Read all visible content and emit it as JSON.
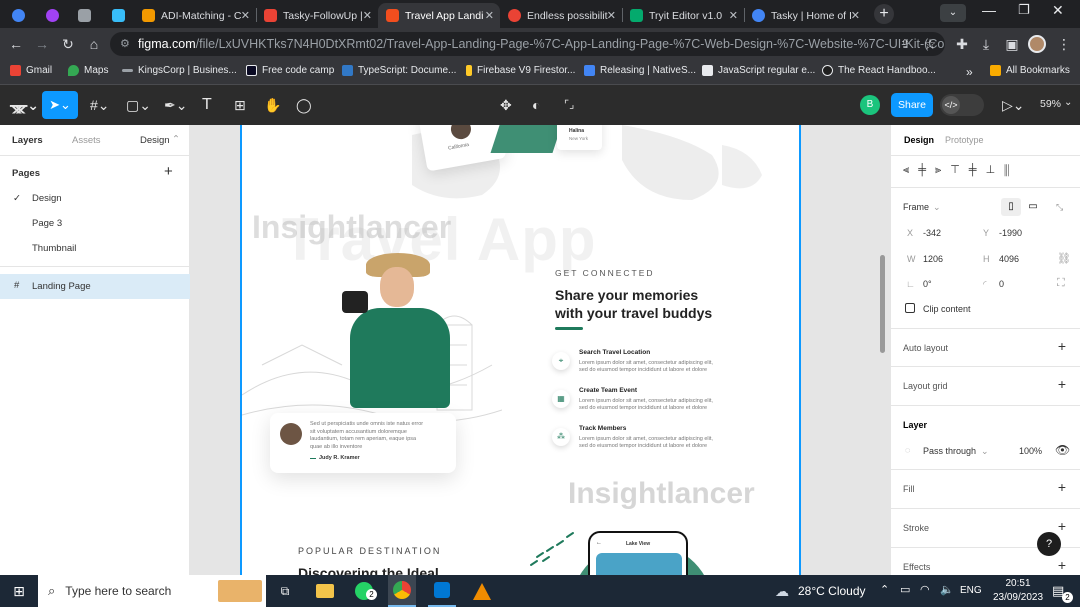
{
  "tabs": [
    {
      "label": "",
      "color": "#4285f4"
    },
    {
      "label": "",
      "color": "#a142f4"
    },
    {
      "label": "",
      "color": "#9aa0a6"
    },
    {
      "label": "",
      "color": "#38bdf8"
    },
    {
      "label": "ADI-Matching - C",
      "color": "#f29900"
    },
    {
      "label": "Tasky-FollowUp |",
      "color": "#ea4335"
    },
    {
      "label": "Travel App Landi",
      "color": "#f24e1e"
    },
    {
      "label": "Endless possibilit",
      "color": "#ea4335"
    },
    {
      "label": "Tryit Editor v1.0",
      "color": "#04aa6d"
    },
    {
      "label": "Tasky | Home of I",
      "color": "#4285f4"
    }
  ],
  "address": {
    "host": "figma.com",
    "path": "/file/LxUVHKTks7N4H0DtXRmt02/Travel-App-Landing-Page-%7C-App-Landing-Page-%7C-Web-Design-%7C-Website-%7C-UI-Kit-(Communit..."
  },
  "bookmarks": [
    {
      "label": "Gmail",
      "color": "#ea4335"
    },
    {
      "label": "Maps",
      "color": "#34a853"
    },
    {
      "label": "KingsCorp | Busines...",
      "color": "#9aa0a6"
    },
    {
      "label": "Free code camp",
      "color": "#e8eaed"
    },
    {
      "label": "TypeScript: Docume...",
      "color": "#3178c6"
    },
    {
      "label": "Firebase V9 Firestor...",
      "color": "#ffca28"
    },
    {
      "label": "Releasing | NativeS...",
      "color": "#4285f4"
    },
    {
      "label": "JavaScript regular e...",
      "color": "#e8eaed"
    },
    {
      "label": "The React Handboo...",
      "color": "#e8eaed"
    },
    {
      "label": "All Bookmarks",
      "color": "#f9ab00"
    }
  ],
  "figma": {
    "share": "Share",
    "zoom": "59%",
    "avatar": "B"
  },
  "left": {
    "tabs": [
      "Layers",
      "Assets",
      "Design"
    ],
    "pages_title": "Pages",
    "pages": [
      "Design",
      "Page 3",
      "Thumbnail"
    ],
    "layer": "Landing Page"
  },
  "canvas": {
    "card_name1": "California",
    "card_name2": "Halina",
    "card_city2": "New York",
    "watermark": "Insightlancer",
    "bg_title": "Travel App",
    "kicker": "GET CONNECTED",
    "heading1": "Share your memories",
    "heading2": "with your travel buddys",
    "features": [
      {
        "title": "Search Travel Location",
        "text1": "Lorem ipsum dolor sit amet, consectetur adipiscing elit,",
        "text2": "sed do eiusmod tempor incididunt ut labore et dolore"
      },
      {
        "title": "Create Team Event",
        "text1": "Lorem ipsum dolor sit amet, consectetur adipiscing elit,",
        "text2": "sed do eiusmod tempor incididunt ut labore et dolore"
      },
      {
        "title": "Track Members",
        "text1": "Lorem ipsum dolor sit amet, consectetur adipiscing elit,",
        "text2": "sed do eiusmod tempor incididunt ut labore et dolore"
      }
    ],
    "quote_l1": "Sed ut perspiciatis unde omnis iste natus error",
    "quote_l2": "sit voluptatem accusantium doloremque",
    "quote_l3": "laudantium, totam rem aperiam, eaque ipsa",
    "quote_l4": "quae ab illo inventore",
    "quote_author": "Judy R. Kramer",
    "popular": "POPULAR DESTINATION",
    "discover": "Discovering the Ideal",
    "phone_title": "Lake View"
  },
  "right": {
    "tabs": [
      "Design",
      "Prototype"
    ],
    "frame": "Frame",
    "x_label": "X",
    "x": "-342",
    "y_label": "Y",
    "y": "-1990",
    "w_label": "W",
    "w": "1206",
    "h_label": "H",
    "h": "4096",
    "rot": "0°",
    "radius": "0",
    "clip": "Clip content",
    "auto_layout": "Auto layout",
    "layout_grid": "Layout grid",
    "layer": "Layer",
    "blend": "Pass through",
    "opacity": "100%",
    "fill": "Fill",
    "stroke": "Stroke",
    "effects": "Effects",
    "help": "?"
  },
  "taskbar": {
    "search": "Type here to search",
    "weather": "28°C  Cloudy",
    "lang": "ENG",
    "time": "20:51",
    "date": "23/09/2023",
    "whatsapp_badge": "2",
    "notif_badge": "2"
  }
}
